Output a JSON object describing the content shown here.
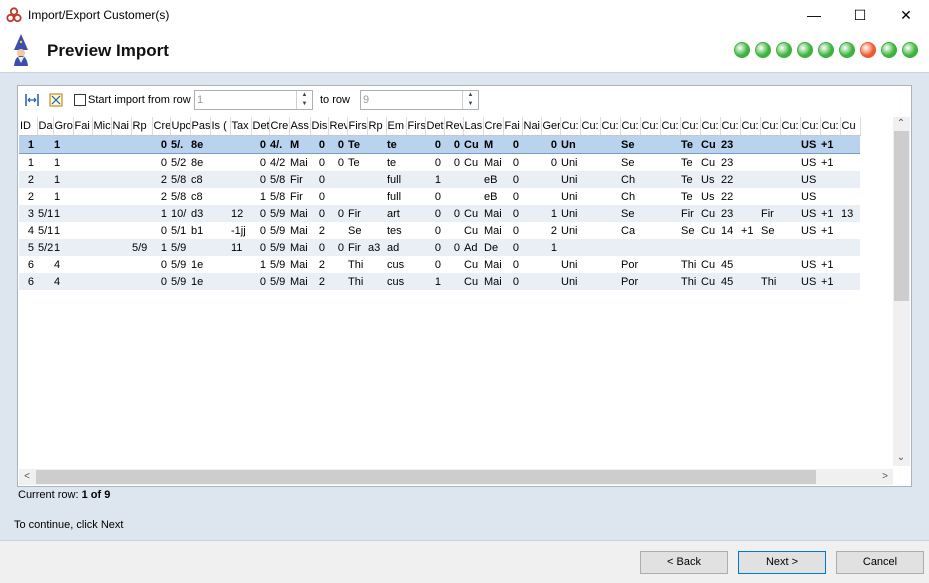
{
  "window": {
    "title": "Import/Export Customer(s)"
  },
  "header": {
    "title": "Preview Import",
    "steps": [
      {
        "color": "#3cb33c"
      },
      {
        "color": "#3cb33c"
      },
      {
        "color": "#3cb33c"
      },
      {
        "color": "#3cb33c"
      },
      {
        "color": "#3cb33c"
      },
      {
        "color": "#3cb33c"
      },
      {
        "color": "#ee5a2e"
      },
      {
        "color": "#3cb33c"
      },
      {
        "color": "#3cb33c"
      }
    ]
  },
  "toolbar": {
    "start_label": "Start import from row",
    "from_value": "1",
    "to_label": "to row",
    "to_value": "9"
  },
  "grid": {
    "columns": [
      "ID",
      "Da",
      "Gro",
      "Fai",
      "Mic",
      "Nai",
      "Rp",
      "Cre",
      "Upc",
      "Pas",
      "Is (",
      "Tax",
      "Det",
      "Cre",
      "Ass",
      "Dis",
      "Rev",
      "Firs",
      "Rp",
      "Em",
      "Firs",
      "Det",
      "Rev",
      "Las",
      "Cre",
      "Fai",
      "Nai",
      "Ger",
      "Cu:",
      "Cu:",
      "Cu:",
      "Cu:",
      "Cu:",
      "Cu:",
      "Cu:",
      "Cu:",
      "Cu:",
      "Cu:",
      "Cu:",
      "Cu:",
      "Cu:",
      "Cu:",
      "Cu"
    ],
    "rows": [
      [
        "1",
        "",
        "1",
        "",
        "",
        "",
        "",
        "0",
        "5/.",
        "8e",
        "",
        "",
        "0",
        "4/.",
        "M",
        "0",
        "0",
        "Te",
        "",
        "te",
        "",
        "0",
        "0",
        "Cu",
        "M",
        "0",
        "",
        "0",
        "Un",
        "",
        "",
        "Se",
        "",
        "",
        "Te",
        "Cu",
        "23",
        "",
        "",
        "",
        "US",
        "+1",
        ""
      ],
      [
        "1",
        "",
        "1",
        "",
        "",
        "",
        "",
        "0",
        "5/2",
        "8e",
        "",
        "",
        "0",
        "4/2",
        "Mai",
        "0",
        "0",
        "Te",
        "",
        "te",
        "",
        "0",
        "0",
        "Cu",
        "Mai",
        "0",
        "",
        "0",
        "Uni",
        "",
        "",
        "Se",
        "",
        "",
        "Te",
        "Cu",
        "23",
        "",
        "",
        "",
        "US",
        "+1",
        ""
      ],
      [
        "2",
        "",
        "1",
        "",
        "",
        "",
        "",
        "2",
        "5/8",
        "c8",
        "",
        "",
        "0",
        "5/8",
        "Fir",
        "0",
        "",
        "",
        "",
        "full",
        "",
        "1",
        "",
        "",
        "eB",
        "0",
        "",
        "",
        "Uni",
        "",
        "",
        "Ch",
        "",
        "",
        "Te",
        "Us",
        "22",
        "",
        "",
        "",
        "US",
        "",
        ""
      ],
      [
        "2",
        "",
        "1",
        "",
        "",
        "",
        "",
        "2",
        "5/8",
        "c8",
        "",
        "",
        "1",
        "5/8",
        "Fir",
        "0",
        "",
        "",
        "",
        "full",
        "",
        "0",
        "",
        "",
        "eB",
        "0",
        "",
        "",
        "Uni",
        "",
        "",
        "Ch",
        "",
        "",
        "Te",
        "Us",
        "22",
        "",
        "",
        "",
        "US",
        "",
        ""
      ],
      [
        "3",
        "5/1",
        "1",
        "",
        "",
        "",
        "",
        "1",
        "10/",
        "d3",
        "",
        "12",
        "0",
        "5/9",
        "Mai",
        "0",
        "0",
        "Fir",
        "",
        "art",
        "",
        "0",
        "0",
        "Cu",
        "Mai",
        "0",
        "",
        "1",
        "Uni",
        "",
        "",
        "Se",
        "",
        "",
        "Fir",
        "Cu",
        "23",
        "",
        "Fir",
        "",
        "US",
        "+1",
        "13"
      ],
      [
        "4",
        "5/1",
        "1",
        "",
        "",
        "",
        "",
        "0",
        "5/1",
        "b1",
        "",
        "-1jj",
        "0",
        "5/9",
        "Mai",
        "2",
        "",
        "Se",
        "",
        "tes",
        "",
        "0",
        "",
        "Cu",
        "Mai",
        "0",
        "",
        "2",
        "Uni",
        "",
        "",
        "Ca",
        "",
        "",
        "Se",
        "Cu",
        "14",
        "+1",
        "Se",
        "",
        "US",
        "+1",
        ""
      ],
      [
        "5",
        "5/2",
        "1",
        "",
        "",
        "",
        "5/9",
        "1",
        "5/9",
        "",
        "",
        "11",
        "0",
        "5/9",
        "Mai",
        "0",
        "0",
        "Fir",
        "a3",
        "ad",
        "",
        "0",
        "0",
        "Ad",
        "De",
        "0",
        "",
        "1",
        "",
        "",
        "",
        "",
        "",
        "",
        "",
        "",
        "",
        "",
        "",
        "",
        "",
        "",
        ""
      ],
      [
        "6",
        "",
        "4",
        "",
        "",
        "",
        "",
        "0",
        "5/9",
        "1e",
        "",
        "",
        "1",
        "5/9",
        "Mai",
        "2",
        "",
        "Thi",
        "",
        "cus",
        "",
        "0",
        "",
        "Cu",
        "Mai",
        "0",
        "",
        "",
        "Uni",
        "",
        "",
        "Por",
        "",
        "",
        "Thi",
        "Cu",
        "45",
        "",
        "",
        "",
        "US",
        "+1",
        ""
      ],
      [
        "6",
        "",
        "4",
        "",
        "",
        "",
        "",
        "0",
        "5/9",
        "1e",
        "",
        "",
        "0",
        "5/9",
        "Mai",
        "2",
        "",
        "Thi",
        "",
        "cus",
        "",
        "1",
        "",
        "Cu",
        "Mai",
        "0",
        "",
        "",
        "Uni",
        "",
        "",
        "Por",
        "",
        "",
        "Thi",
        "Cu",
        "45",
        "",
        "Thi",
        "",
        "US",
        "+1",
        ""
      ]
    ]
  },
  "status": {
    "current_row_label": "Current row:",
    "current_row_value": "1 of 9",
    "hint": "To continue, click Next"
  },
  "buttons": {
    "back": "< Back",
    "next": "Next >",
    "cancel": "Cancel"
  }
}
